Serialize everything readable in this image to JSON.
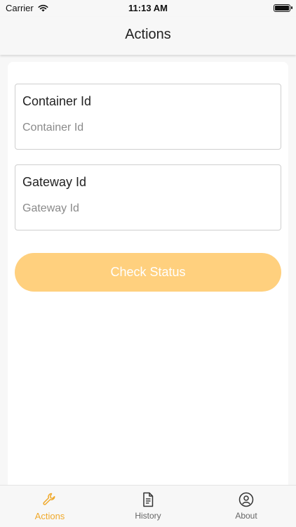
{
  "status_bar": {
    "carrier": "Carrier",
    "time": "11:13 AM"
  },
  "nav": {
    "title": "Actions"
  },
  "form": {
    "container": {
      "label": "Container Id",
      "placeholder": "Container Id",
      "value": ""
    },
    "gateway": {
      "label": "Gateway Id",
      "placeholder": "Gateway Id",
      "value": ""
    },
    "check_button": "Check Status"
  },
  "tabs": [
    {
      "label": "Actions",
      "icon": "wrench-icon",
      "active": true
    },
    {
      "label": "History",
      "icon": "document-icon",
      "active": false
    },
    {
      "label": "About",
      "icon": "person-circle-icon",
      "active": false
    }
  ],
  "colors": {
    "accent": "#f0a92b",
    "button": "#ffd07e",
    "background": "#f7f7f7"
  }
}
